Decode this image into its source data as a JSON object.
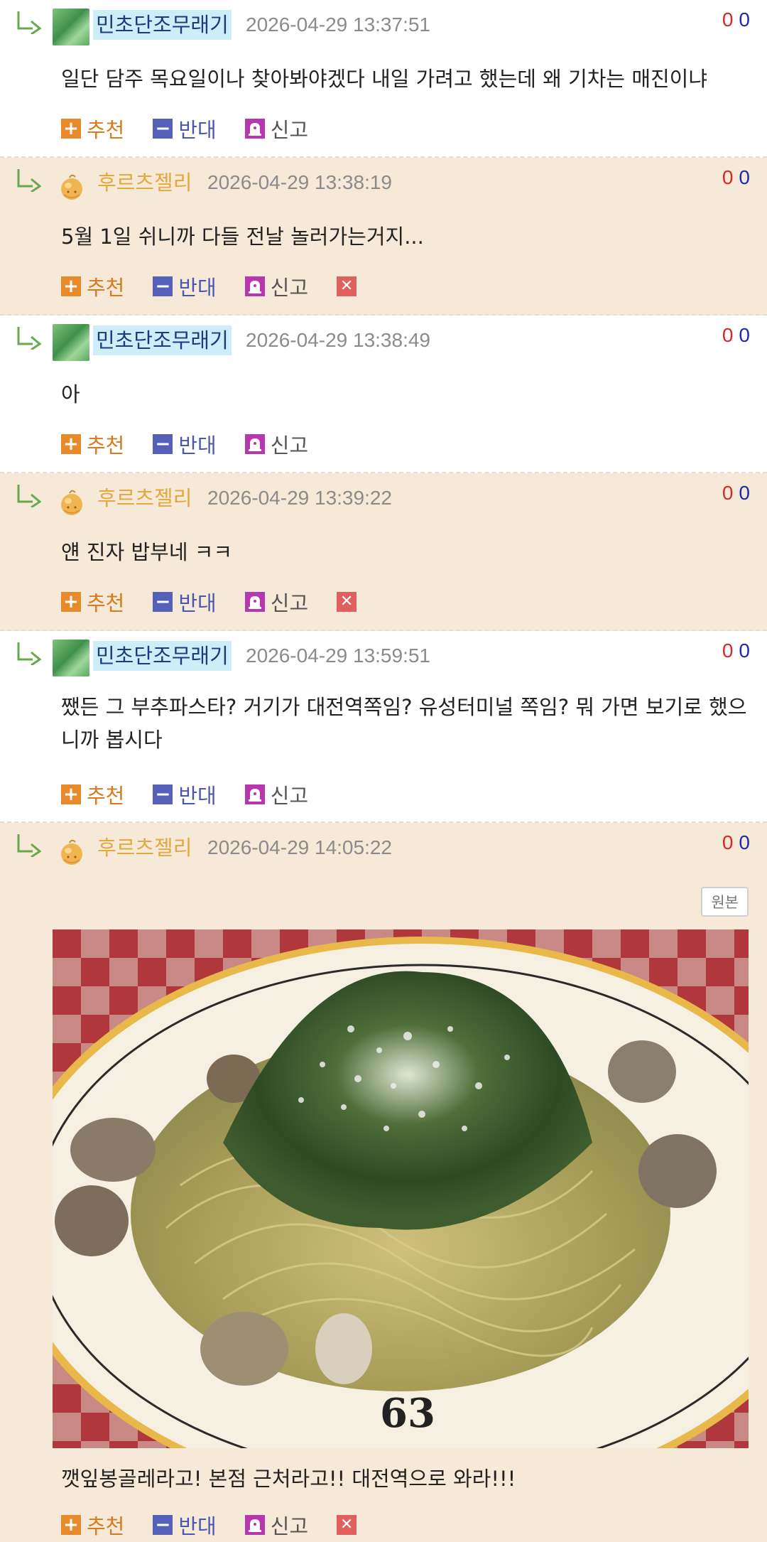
{
  "comments": [
    {
      "nick": "민초단조무래기",
      "time": "2026-04-29 13:37:51",
      "up": "0",
      "down": "0",
      "text": "일단 담주 목요일이나 찾아봐야겠다 내일 가려고 했는데 왜 기차는 매진이냐"
    },
    {
      "nick": "후르츠젤리",
      "time": "2026-04-29 13:38:19",
      "up": "0",
      "down": "0",
      "text": "5월 1일 쉬니까 다들 전날 놀러가는거지..."
    },
    {
      "nick": "민초단조무래기",
      "time": "2026-04-29 13:38:49",
      "up": "0",
      "down": "0",
      "text": "아"
    },
    {
      "nick": "후르츠젤리",
      "time": "2026-04-29 13:39:22",
      "up": "0",
      "down": "0",
      "text": "얜 진자 밥부네 ㅋㅋ"
    },
    {
      "nick": "민초단조무래기",
      "time": "2026-04-29 13:59:51",
      "up": "0",
      "down": "0",
      "text": "쨌든 그 부추파스타? 거기가 대전역쪽임? 유성터미널 쪽임? 뭐 가면 보기로 했으니까 봅시다"
    },
    {
      "nick": "후르츠젤리",
      "time": "2026-04-29 14:05:22",
      "up": "0",
      "down": "0",
      "original_button": "원본",
      "text": "깻잎봉골레라고! 본점 근처라고!! 대전역으로 와라!!!"
    }
  ],
  "actions": {
    "recommend": "추천",
    "oppose": "반대",
    "report": "신고"
  },
  "photo_plate_number": "63",
  "icons": {
    "reply": "reply-arrow-icon",
    "recommend": "plus-icon",
    "oppose": "minus-icon",
    "report": "siren-icon",
    "delete": "close-icon"
  },
  "colors": {
    "recommend": "#e8892a",
    "oppose": "#5560b8",
    "report": "#b837b0",
    "delete": "#e06060",
    "other_bg": "#f6e9d8",
    "nick_other": "#e3a93e",
    "nick_mine_bg": "#cdeef9"
  }
}
